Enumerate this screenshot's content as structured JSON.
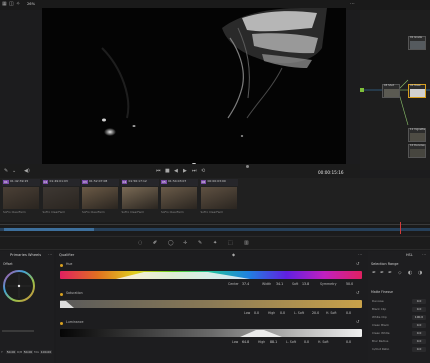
{
  "topbar": {
    "zoom_label": "26%"
  },
  "viewer": {
    "timecode": "00:00:15:16"
  },
  "clips": [
    {
      "num": "01",
      "tc": "01:42:39:15",
      "name": "SoFro ClearFarm"
    },
    {
      "num": "02",
      "tc": "01:49:01:03",
      "name": "SoFro ClearFarm"
    },
    {
      "num": "03",
      "tc": "01:52:07:08",
      "name": "SoFro ClearFarm"
    },
    {
      "num": "04",
      "tc": "01:56:17:12",
      "name": "SoFro ClearFarm"
    },
    {
      "num": "05",
      "tc": "01:54:03:07",
      "name": "SoFro ClearFarm"
    },
    {
      "num": "06",
      "tc": "00:00:03:00",
      "name": "SoFro ClearFarm"
    }
  ],
  "nodes": [
    {
      "label": "01 Grade"
    },
    {
      "label": "03 Shot"
    },
    {
      "label": "04 Mask"
    },
    {
      "label": "11 Vignette"
    },
    {
      "label": "10 Denoise"
    }
  ],
  "leftpanel": {
    "title": "Primaries Wheels",
    "wheel_label": "Offset",
    "val_a": "50.00",
    "val_b": "50.00",
    "val_c": "100.00",
    "lbl_a": "Y",
    "lbl_b": "R/B",
    "lbl_c": "Mix"
  },
  "qualifier": {
    "title": "Qualifier",
    "hue": {
      "label": "Hue",
      "center_k": "Center",
      "center_v": "37.4",
      "width_k": "Width",
      "width_v": "34.1",
      "soft_k": "Soft",
      "soft_v": "13.8",
      "sym_k": "Symmetry",
      "sym_v": "50.0"
    },
    "sat": {
      "label": "Saturation",
      "low_k": "Low",
      "low_v": "0.0",
      "high_k": "High",
      "high_v": "0.0",
      "lsoft_k": "L. Soft",
      "lsoft_v": "20.0",
      "hsoft_k": "H. Soft",
      "hsoft_v": "0.0"
    },
    "lum": {
      "label": "Luminance",
      "low_k": "Low",
      "low_v": "64.8",
      "high_k": "High",
      "high_v": "88.1",
      "lsoft_k": "L. Soft",
      "lsoft_v": "0.0",
      "hsoft_k": "H. Soft",
      "hsoft_v": "0.0"
    }
  },
  "rightpanel": {
    "title": "Selection Range",
    "mode": "HSL",
    "section": "Matte Finesse",
    "rows": [
      {
        "k": "Denoise",
        "v": "0.0"
      },
      {
        "k": "Black Clip",
        "v": "0.0"
      },
      {
        "k": "White Clip",
        "v": "100.0"
      },
      {
        "k": "Clean Black",
        "v": "0.0"
      },
      {
        "k": "Clean White",
        "v": "0.0"
      },
      {
        "k": "Blur Radius",
        "v": "0.0"
      },
      {
        "k": "In/Out Ratio",
        "v": "0.0"
      }
    ]
  },
  "colors": {
    "accent": "#d8a020",
    "clip_num": "#7b4ba8"
  }
}
